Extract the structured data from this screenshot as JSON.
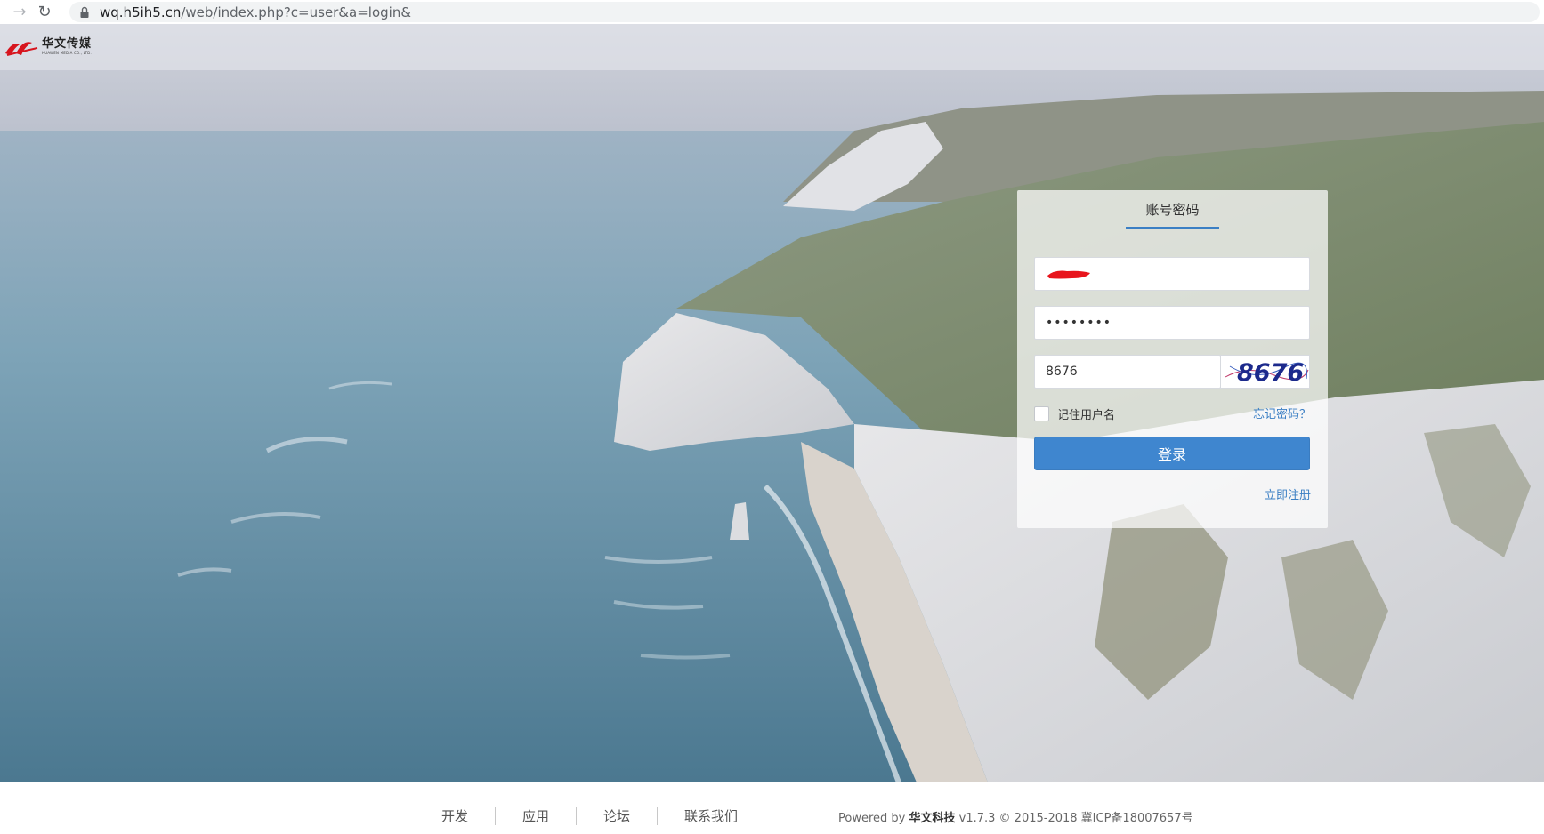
{
  "browser": {
    "url_host": "wq.h5ih5.cn",
    "url_path": "/web/index.php?c=user&a=login&"
  },
  "header": {
    "logo_cn": "华文传媒",
    "logo_en": "HUAWEN MEDIA CO., LTD."
  },
  "login": {
    "tab_label": "账号密码",
    "password_value": "••••••••",
    "captcha_value": "8676",
    "captcha_image_text": "8676",
    "remember_label": "记住用户名",
    "forgot_label": "忘记密码？",
    "submit_label": "登录",
    "register_label": "立即注册"
  },
  "footer": {
    "links": [
      "开发",
      "应用",
      "论坛",
      "联系我们"
    ],
    "powered_prefix": "Powered by ",
    "company": "华文科技",
    "version_text": " v1.7.3 © 2015-2018 ",
    "icp": "冀ICP备18007657号"
  },
  "colors": {
    "accent": "#3f86cf",
    "link": "#3b7fc4"
  },
  "icons": {
    "back": "arrow-back-icon",
    "reload": "reload-icon",
    "lock": "lock-icon"
  }
}
